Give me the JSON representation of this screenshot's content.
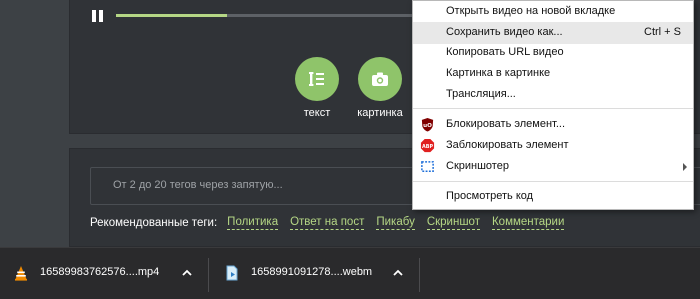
{
  "player": {
    "progress": 0.37
  },
  "tools": [
    {
      "label": "текст",
      "icon": "text-icon"
    },
    {
      "label": "картинка",
      "icon": "camera-icon"
    }
  ],
  "tags": {
    "placeholder": "От 2 до 20 тегов через запятую...",
    "recommended_label": "Рекомендованные теги:",
    "recommended": [
      "Политика",
      "Ответ на пост",
      "Пикабу",
      "Скриншот",
      "Комментарии"
    ]
  },
  "context_menu": {
    "items": [
      {
        "label": "Открыть видео на новой вкладке"
      },
      {
        "label": "Сохранить видео как...",
        "shortcut": "Ctrl + S",
        "highlighted": true
      },
      {
        "label": "Копировать URL видео"
      },
      {
        "label": "Картинка в картинке"
      },
      {
        "label": "Трансляция..."
      },
      {
        "label": "Блокировать элемент...",
        "icon": "ublock-icon"
      },
      {
        "label": "Заблокировать элемент",
        "icon": "adblock-plus-icon"
      },
      {
        "label": "Скриншотер",
        "icon": "screenshot-icon",
        "submenu": true
      },
      {
        "label": "Просмотреть код"
      }
    ]
  },
  "downloads": [
    {
      "filename": "1658998376257​6....mp4",
      "icon": "vlc-icon"
    },
    {
      "filename": "16589910912​78....webm",
      "icon": "file-icon"
    }
  ],
  "colors": {
    "accent": "#8fc46a",
    "tag_link": "#b5d785",
    "panel": "#303337",
    "background": "#3d4145"
  }
}
